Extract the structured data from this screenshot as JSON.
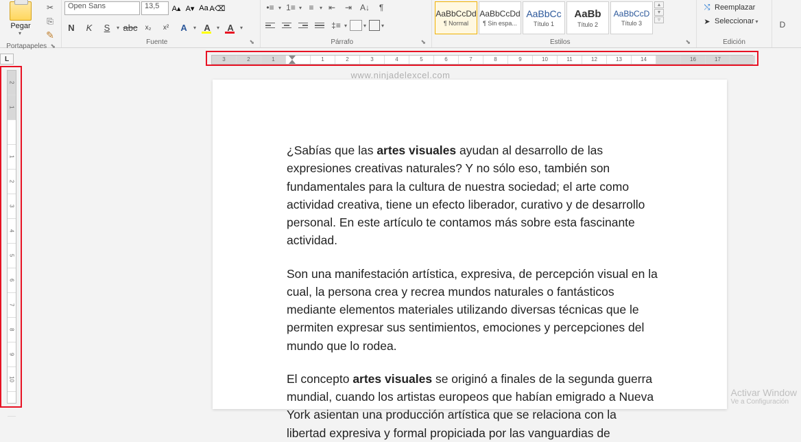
{
  "clipboard": {
    "label": "Portapapeles",
    "paste": "Pegar"
  },
  "font": {
    "label": "Fuente",
    "name": "Open Sans",
    "size": "13,5",
    "bold": "N",
    "italic": "K",
    "underline": "S",
    "strike": "abc",
    "sub": "x₂",
    "sup": "x²",
    "effect": "A",
    "highlight": "A",
    "color": "A"
  },
  "paragraph": {
    "label": "Párrafo"
  },
  "styles": {
    "label": "Estilos",
    "items": [
      {
        "preview": "AaBbCcDd",
        "name": "¶ Normal"
      },
      {
        "preview": "AaBbCcDd",
        "name": "¶ Sin espa..."
      },
      {
        "preview": "AaBbCc",
        "name": "Título 1"
      },
      {
        "preview": "AaBb",
        "name": "Título 2"
      },
      {
        "preview": "AaBbCcD",
        "name": "Título 3"
      }
    ]
  },
  "editing": {
    "label": "Edición",
    "replace": "Reemplazar",
    "select": "Seleccionar"
  },
  "ruler": {
    "h": [
      "3",
      "2",
      "1",
      "",
      "1",
      "2",
      "3",
      "4",
      "5",
      "6",
      "7",
      "8",
      "9",
      "10",
      "11",
      "12",
      "13",
      "14",
      "",
      "16",
      "17",
      ""
    ],
    "v": [
      "2",
      "1",
      "",
      "1",
      "2",
      "3",
      "4",
      "5",
      "6",
      "7",
      "8",
      "9",
      "10",
      ""
    ]
  },
  "watermark": "www.ninjadelexcel.com",
  "doc": {
    "p1a": "¿Sabías que las ",
    "p1b": "artes visuales",
    "p1c": " ayudan al desarrollo de las expresiones creativas naturales? Y no sólo eso, también son fundamentales para la cultura de nuestra sociedad; el arte como actividad creativa, tiene un efecto liberador, curativo y de desarrollo personal. En este artículo te contamos más sobre esta fascinante actividad.",
    "p2": "Son una manifestación artística, expresiva, de percepción visual en la cual, la persona crea y recrea mundos naturales o fantásticos mediante elementos materiales utilizando diversas técnicas que le permiten expresar sus sentimientos, emociones y percepciones del mundo que lo rodea.",
    "p3a": "El concepto ",
    "p3b": "artes visuales",
    "p3c": " se originó a finales de la segunda guerra mundial, cuando los artistas europeos que habían emigrado a Nueva York asientan una producción artística que se relaciona con la libertad expresiva y formal propiciada por las vanguardias de"
  },
  "activate": {
    "line1": "Activar Window",
    "line2": "Ve a Configuración"
  },
  "tab_tool": "L",
  "dict": "D"
}
